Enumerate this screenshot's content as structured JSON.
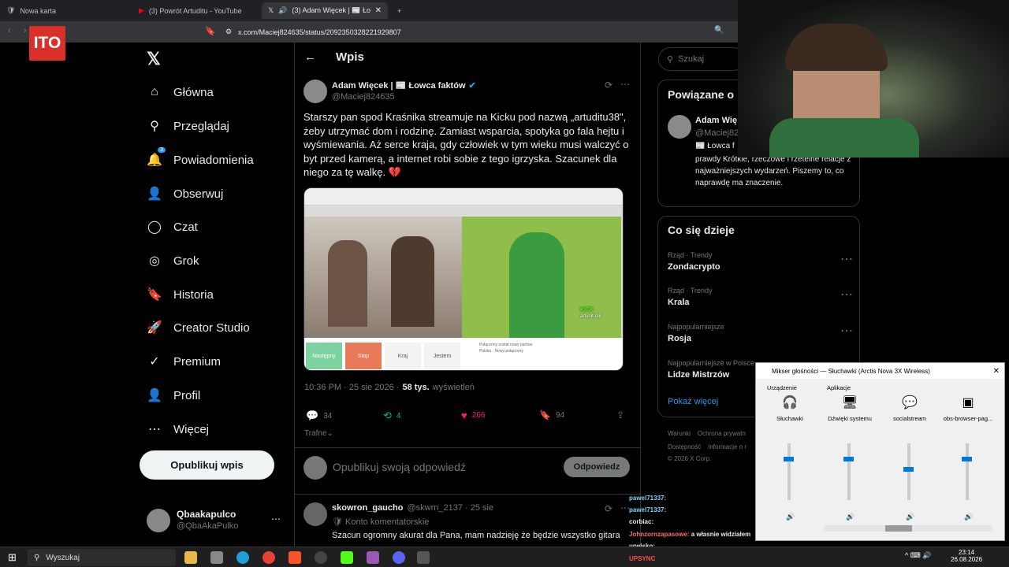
{
  "browser": {
    "tabs": [
      {
        "label": "Nowa karta",
        "icon": "shield-icon"
      },
      {
        "label": "(3) Powrót Artuditu - YouTube",
        "icon": "youtube-icon"
      },
      {
        "label": "(3) Adam Więcek | 📰 Łowca",
        "icon": "x-logo-icon"
      }
    ],
    "url": "x.com/Maciej824635/status/2092350328221929807"
  },
  "overlay_logo": "ITO",
  "nav": {
    "items": [
      "Główna",
      "Przeglądaj",
      "Powiadomienia",
      "Obserwuj",
      "Czat",
      "Grok",
      "Historia",
      "Creator Studio",
      "Premium",
      "Profil",
      "Więcej"
    ],
    "notification_count": "3",
    "post_button": "Opublikuj wpis",
    "account_name": "Qbaakapulco",
    "account_handle": "@QbaAkaPulko"
  },
  "post": {
    "header": "Wpis",
    "author_name": "Adam Więcek | 📰 Łowca faktów",
    "author_handle": "@Maciej824635",
    "text": "Starszy pan spod Kraśnika streamuje na Kicku pod nazwą „artuditu38\", żeby utrzymać dom i rodzinę. Zamiast wsparcia, spotyka go fala hejtu i wyśmiewania. Aż serce kraja, gdy człowiek w tym wieku musi walczyć o byt przed kamerą, a internet robi sobie z tego igrzyska. Szacunek dla niego za tę walkę. 💔",
    "media": {
      "buttons": [
        "Następny",
        "Stop",
        "Kraj",
        "Jestem"
      ],
      "overlay_brand": "KICK",
      "overlay_channel": "artuditu38",
      "chat_text_1": "Połączony został nowy partner",
      "chat_text_2": "Polska · Nowy połączony"
    },
    "time": "10:36 PM · 25 sie 2026 ·",
    "views_count": "58 tys.",
    "views_label": "wyświetleń",
    "replies": "34",
    "reposts": "4",
    "likes": "266",
    "bookmarks": "94",
    "sort_label": "Trafne",
    "reply_placeholder": "Opublikuj swoją odpowiedź",
    "reply_button": "Odpowiedz"
  },
  "reply": {
    "name": "skowron_gaucho",
    "handle": "@skwrn_2137 · 25 sie",
    "badge": "Konto komentatorskie",
    "text": "Szacun ogromny akurat dla Pana, mam nadzieję że będzie wszystko gitara"
  },
  "right": {
    "search_placeholder": "Szukaj",
    "related_title": "Powiązane o",
    "related_name": "Adam Wię",
    "related_handle": "@Maciej82",
    "related_bio_1": "📰 Łowca f",
    "related_bio_2": "prawdy Krótkie, rzeczowe i rzetelne relacje z najważniejszych wydarzeń. Piszemy to, co naprawdę ma znaczenie.",
    "trends_title": "Co się dzieje",
    "trends": [
      {
        "context": "Rząd · Trendy",
        "name": "Zondacrypto"
      },
      {
        "context": "Rząd · Trendy",
        "name": "Krala"
      },
      {
        "context": "Najpopularniejsze",
        "name": "Rosja"
      },
      {
        "context": "Najpopularniejsze w Polsce",
        "name": "Lidze Mistrzów"
      }
    ],
    "show_more": "Pokaż więcej",
    "footer_1": "Warunki    Ochrona prywatn",
    "footer_2": "Dostępność    Informacje o r",
    "footer_3": "© 2026 X Corp."
  },
  "mixer": {
    "title": "Mikser głośności — Słuchawki (Arctis Nova 3X Wireless)",
    "device_label": "Urządzenie",
    "apps_label": "Aplikacje",
    "channels": [
      {
        "name": "Słuchawki",
        "level": 0.75
      },
      {
        "name": "Dźwięki systemu",
        "level": 0.75
      },
      {
        "name": "socialstream",
        "level": 0.55
      },
      {
        "name": "obs-browser-pag...",
        "level": 0.75
      }
    ]
  },
  "chat": [
    {
      "user": "pawel71337:",
      "msg": "",
      "color": "#7dd3fc"
    },
    {
      "user": "pawel71337:",
      "msg": "",
      "color": "#7dd3fc"
    },
    {
      "user": "corbiac:",
      "msg": "",
      "color": "#e7e9ea"
    },
    {
      "user": "Johnzornzapasowe:",
      "msg": "a własnie widziałem",
      "color": "#ff6b6b"
    },
    {
      "user": "urwisko:",
      "msg": "",
      "color": "#e7e9ea"
    },
    {
      "user": "UPSYNC",
      "msg": "",
      "color": "#ff4d4d"
    }
  ],
  "taskbar": {
    "search_label": "Wyszukaj",
    "time": "23:14",
    "date": "26.08.2026"
  }
}
